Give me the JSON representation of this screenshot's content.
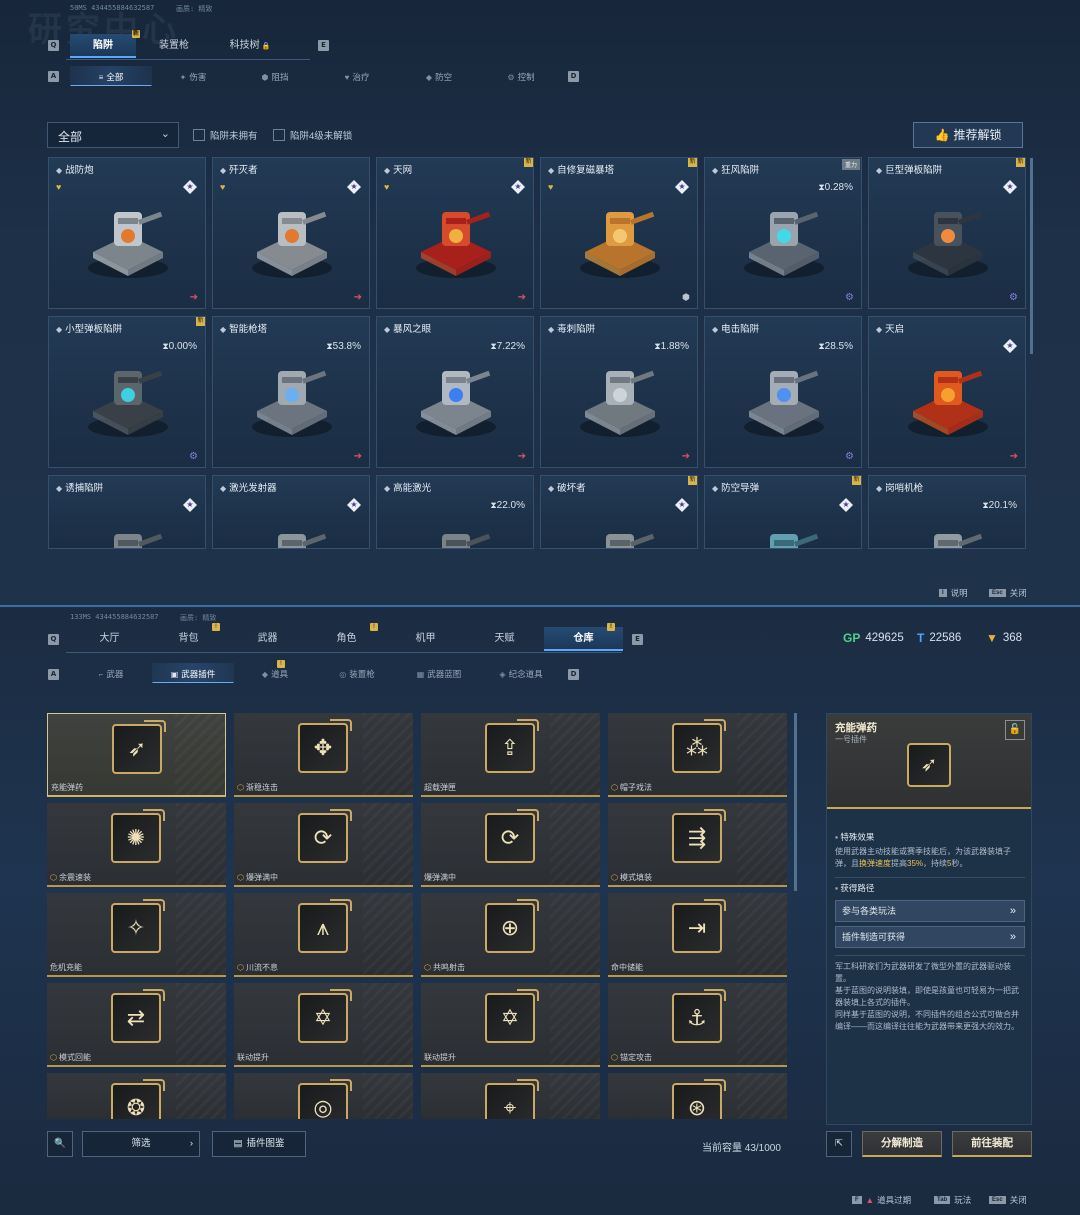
{
  "top": {
    "meta": "50MS  434455884632587",
    "meta2": "画质: 精致",
    "bigtitle": "研究中心",
    "tabs": [
      {
        "label": "陷阱",
        "active": true,
        "badge": true
      },
      {
        "label": "装置枪",
        "active": false,
        "badge": false
      },
      {
        "label": "科技树",
        "active": false,
        "badge": false,
        "lock": true
      }
    ],
    "key_left": "Q",
    "key_right": "E",
    "subtabs": [
      {
        "icon": "≡",
        "label": "全部",
        "active": true
      },
      {
        "icon": "✦",
        "label": "伤害",
        "active": false
      },
      {
        "icon": "⬢",
        "label": "阻挡",
        "active": false
      },
      {
        "icon": "♥",
        "label": "治疗",
        "active": false
      },
      {
        "icon": "◆",
        "label": "防空",
        "active": false
      },
      {
        "icon": "⚙",
        "label": "控制",
        "active": false
      }
    ],
    "subkey_left": "A",
    "subkey_right": "D",
    "dropdown": "全部",
    "filter1": "陷阱未拥有",
    "filter2": "陷阱4级未解锁",
    "recommend": "推荐解锁",
    "cards": [
      {
        "name": "战防炮",
        "heart": true,
        "star": true,
        "corner": "arrow",
        "tag": ""
      },
      {
        "name": "歼灭者",
        "heart": true,
        "star": true,
        "corner": "arrow",
        "tag": ""
      },
      {
        "name": "天网",
        "heart": true,
        "star": true,
        "corner": "arrow",
        "tag": "new"
      },
      {
        "name": "自修复磁暴塔",
        "heart": true,
        "star": true,
        "corner": "shield",
        "tag": "new"
      },
      {
        "name": "狂风陷阱",
        "pct": "0.28%",
        "corner": "gear",
        "tag": "重力"
      },
      {
        "name": "巨型弹板陷阱",
        "star": true,
        "corner": "gear",
        "tag": "new"
      },
      {
        "name": "小型弹板陷阱",
        "pct": "0.00%",
        "corner": "gear",
        "tag": "new"
      },
      {
        "name": "智能枪塔",
        "pct": "53.8%",
        "corner": "arrow",
        "tag": ""
      },
      {
        "name": "暴风之眼",
        "pct": "7.22%",
        "corner": "arrow",
        "tag": ""
      },
      {
        "name": "毒刺陷阱",
        "pct": "1.88%",
        "corner": "arrow",
        "tag": ""
      },
      {
        "name": "电击陷阱",
        "pct": "28.5%",
        "corner": "gear",
        "tag": ""
      },
      {
        "name": "天启",
        "star": true,
        "corner": "arrow",
        "tag": ""
      },
      {
        "name": "诱捕陷阱",
        "star": true,
        "corner": "",
        "tag": ""
      },
      {
        "name": "激光发射器",
        "star": true,
        "corner": "",
        "tag": ""
      },
      {
        "name": "高能激光",
        "pct": "22.0%",
        "corner": "",
        "tag": ""
      },
      {
        "name": "破坏者",
        "star": true,
        "corner": "",
        "tag": "new"
      },
      {
        "name": "防空导弹",
        "star": true,
        "corner": "",
        "tag": "new"
      },
      {
        "name": "岗哨机枪",
        "pct": "20.1%",
        "corner": "",
        "tag": ""
      }
    ],
    "hint_help": "说明",
    "hint_help_key": "I",
    "hint_close": "关闭",
    "hint_close_key": "Esc"
  },
  "bottom": {
    "meta": "133MS  434455884632587",
    "meta2": "画质: 精致",
    "tabs": [
      {
        "label": "大厅",
        "active": false,
        "badge": false
      },
      {
        "label": "背包",
        "active": false,
        "badge": true
      },
      {
        "label": "武器",
        "active": false,
        "badge": false
      },
      {
        "label": "角色",
        "active": false,
        "badge": true
      },
      {
        "label": "机甲",
        "active": false,
        "badge": false
      },
      {
        "label": "天赋",
        "active": false,
        "badge": false
      },
      {
        "label": "仓库",
        "active": true,
        "badge": true
      }
    ],
    "key_left": "Q",
    "key_right": "E",
    "currency": [
      {
        "icon": "GP",
        "value": "429625",
        "color": "#4fd18a"
      },
      {
        "icon": "T",
        "value": "22586",
        "color": "#4aa8ff"
      },
      {
        "icon": "▼",
        "value": "368",
        "color": "#e8b23a"
      }
    ],
    "subtabs": [
      {
        "icon": "⌐",
        "label": "武器",
        "active": false
      },
      {
        "icon": "▣",
        "label": "武器插件",
        "active": true
      },
      {
        "icon": "◆",
        "label": "道具",
        "active": false,
        "badge": true
      },
      {
        "icon": "◎",
        "label": "装置枪",
        "active": false
      },
      {
        "icon": "▦",
        "label": "武器蓝图",
        "active": false
      },
      {
        "icon": "◈",
        "label": "纪念道具",
        "active": false
      }
    ],
    "subkey_left": "A",
    "subkey_right": "D",
    "slots": [
      {
        "label": "充能弹药",
        "glyph": "➶",
        "mark": false
      },
      {
        "label": "渐稳连击",
        "glyph": "✥",
        "mark": true
      },
      {
        "label": "超载弹匣",
        "glyph": "⇪",
        "mark": false
      },
      {
        "label": "帽子戏法",
        "glyph": "⁂",
        "mark": true
      },
      {
        "label": "余震速装",
        "glyph": "✺",
        "mark": true
      },
      {
        "label": "爆弹满中",
        "glyph": "⟳",
        "mark": true
      },
      {
        "label": "爆弹满中",
        "glyph": "⟳",
        "mark": false
      },
      {
        "label": "模式填装",
        "glyph": "⇶",
        "mark": true
      },
      {
        "label": "危机充能",
        "glyph": "✧",
        "mark": false
      },
      {
        "label": "川流不息",
        "glyph": "⩚",
        "mark": true
      },
      {
        "label": "共鸣射击",
        "glyph": "⊕",
        "mark": true
      },
      {
        "label": "命中储能",
        "glyph": "⇥",
        "mark": false
      },
      {
        "label": "模式回能",
        "glyph": "⇄",
        "mark": true
      },
      {
        "label": "联动提升",
        "glyph": "✡",
        "mark": false
      },
      {
        "label": "联动提升",
        "glyph": "✡",
        "mark": false
      },
      {
        "label": "锚定攻击",
        "glyph": "⚓",
        "mark": true
      },
      {
        "label": "",
        "glyph": "❂",
        "mark": false
      },
      {
        "label": "",
        "glyph": "◎",
        "mark": false
      },
      {
        "label": "",
        "glyph": "⌖",
        "mark": false
      },
      {
        "label": "",
        "glyph": "⊛",
        "mark": false
      }
    ],
    "detail": {
      "title": "充能弹药",
      "subtitle": "一号插件",
      "effect_title": "特殊效果",
      "effect_pre": "使用武器主动技能或赛季技能后，为该武器装填子弹，且",
      "effect_hl1": "换弹速度",
      "effect_mid": "提高",
      "effect_hl2": "35%",
      "effect_mid2": "，持续",
      "effect_hl3": "5",
      "effect_post": "秒。",
      "route_title": "获得路径",
      "route1": "参与各类玩法",
      "route2": "插件制造可获得",
      "lore": "军工科研家们为武器研发了微型外置的武器驱动装置。\n基于蓝图的说明装填，即使是孩童也可轻易为一把武器装填上各式的插件。\n同样基于蓝图的说明，不同插件的组合公式可做合并编译——而这编译往往能为武器带来更强大的效力。"
    },
    "filter_label": "筛选",
    "catalog_label": "插件图鉴",
    "capacity": "当前容量 43/1000",
    "dismantle": "分解制造",
    "equip": "前往装配",
    "hint_expired": "道具过期",
    "hint_expired_key": "F",
    "hint_play": "玩法",
    "hint_play_key": "Tab",
    "hint_close": "关闭",
    "hint_close_key": "Esc"
  }
}
